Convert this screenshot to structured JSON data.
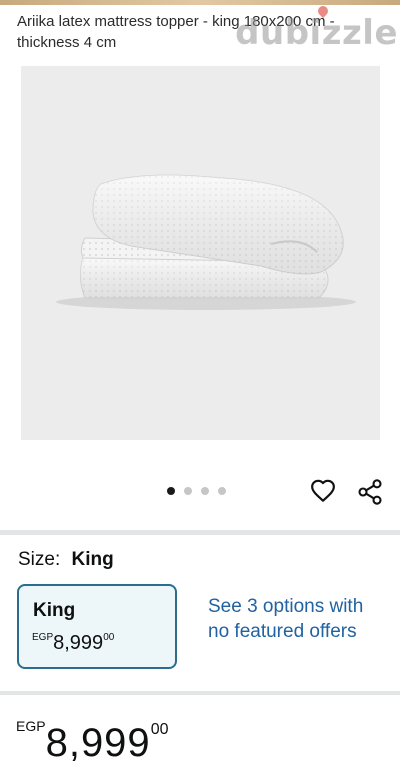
{
  "product": {
    "title": "Ariika latex mattress topper - king 180x200 cm - thickness 4 cm",
    "image_alt": "white latex mattress topper folded"
  },
  "watermark": {
    "text": "dubizzle"
  },
  "carousel": {
    "total_images": 4,
    "active_index": 0
  },
  "icons": {
    "wishlist": "heart-icon",
    "share": "share-icon"
  },
  "size": {
    "label": "Size:",
    "selected": "King",
    "option": {
      "name": "King",
      "currency": "EGP",
      "whole": "8,999",
      "fraction": "00"
    },
    "see_options": "See 3 options with no featured offers"
  },
  "price": {
    "currency": "EGP",
    "whole": "8,999",
    "fraction": "00"
  },
  "colors": {
    "link": "#2162a1",
    "selected_border": "#2b6d8c",
    "selected_bg": "#edf7f9"
  }
}
